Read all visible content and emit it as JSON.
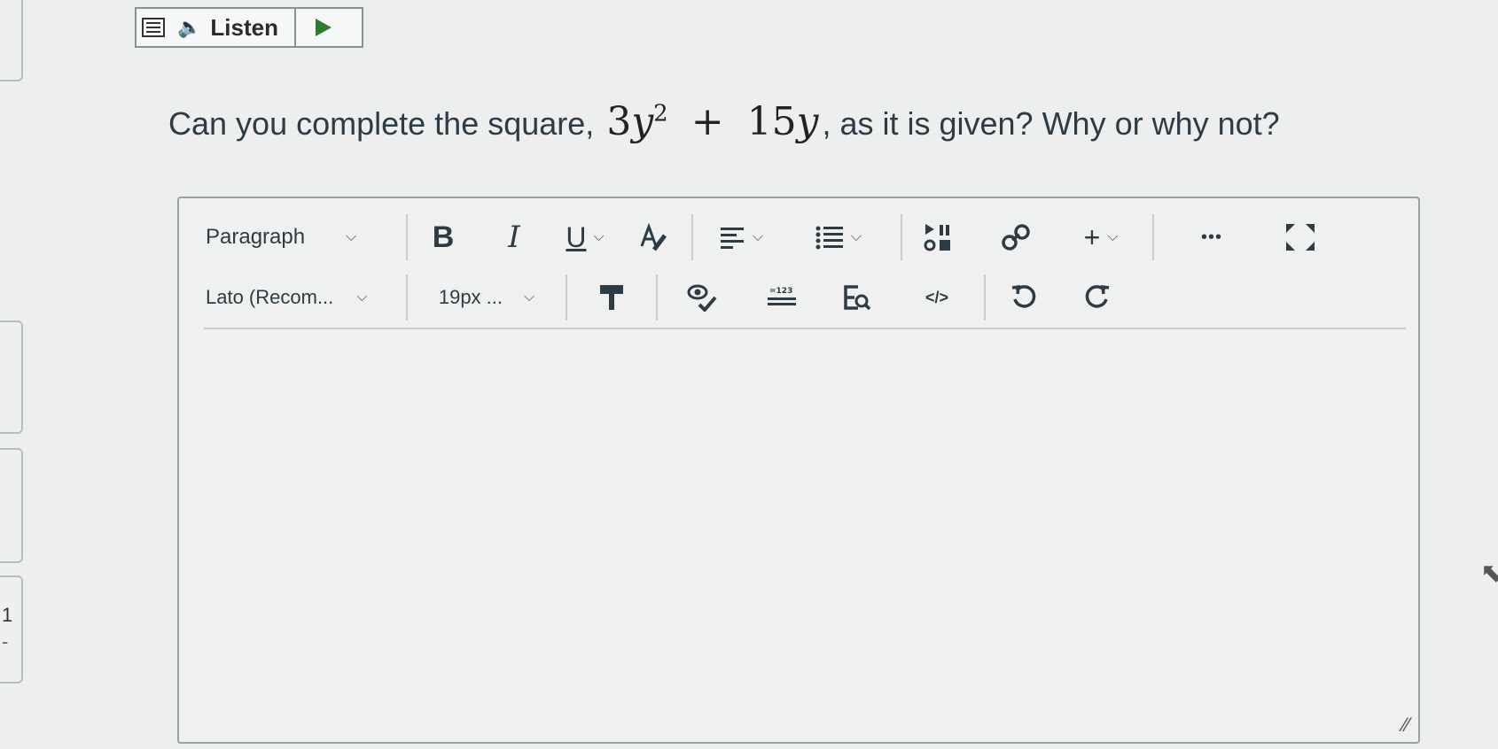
{
  "listen": {
    "label": "Listen"
  },
  "question": {
    "prefix": "Can you complete the square,",
    "math_coef": "3",
    "math_var": "y",
    "math_exp": "2",
    "math_op": "+",
    "math_term": "15",
    "math_var2": "y",
    "suffix": ", as it is given? Why or why not?"
  },
  "toolbar": {
    "block_format": "Paragraph",
    "bold": "B",
    "italic": "I",
    "underline": "U",
    "more": "•••",
    "font_family": "Lato (Recom...",
    "font_size": "19px ...",
    "html_editor": "</>",
    "insert": "+"
  },
  "sidebar": {
    "page_number": "1",
    "dash": "-"
  }
}
